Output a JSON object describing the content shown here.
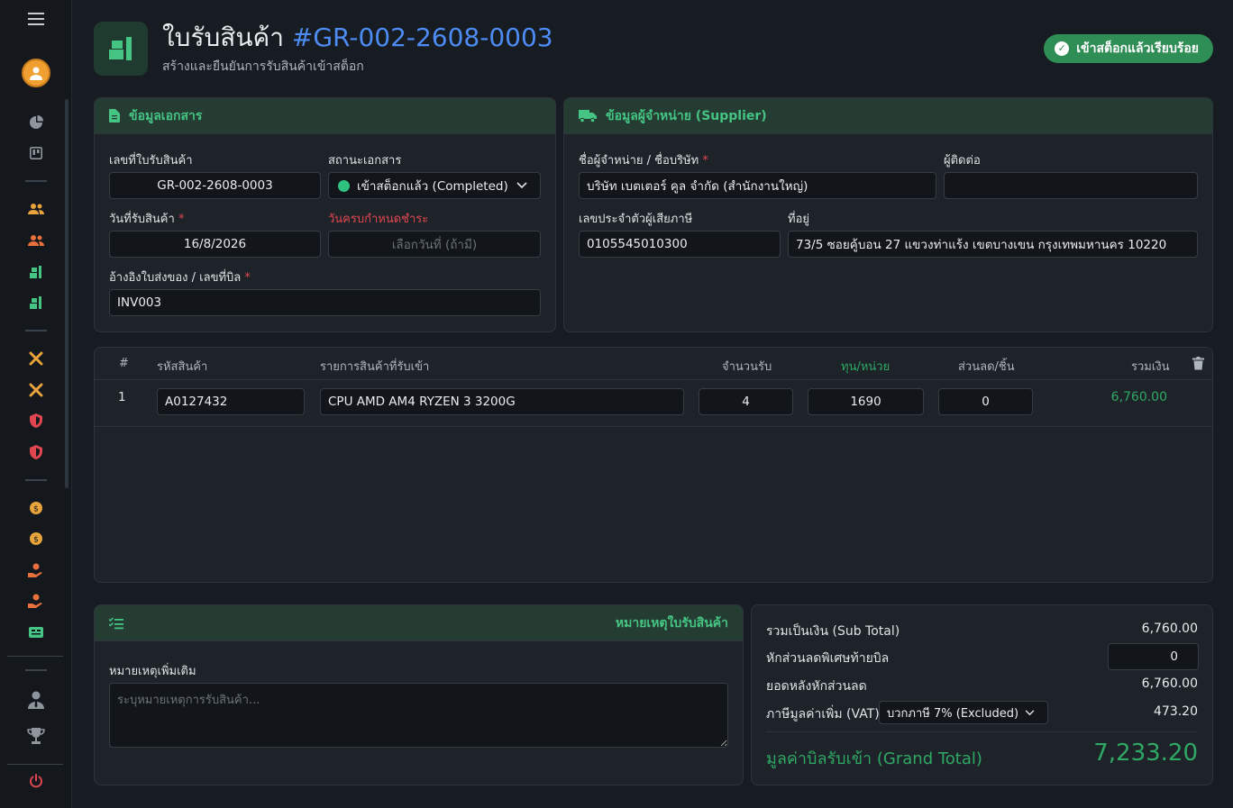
{
  "sidebar": {
    "menu_icon": "hamburger-icon",
    "avatar_icon": "user-avatar-icon",
    "items": [
      {
        "icon": "pie-chart-icon",
        "color": "#8e959c"
      },
      {
        "icon": "kanban-icon",
        "color": "#8e959c"
      },
      {
        "icon": "users-icon",
        "color": "#e8a33c"
      },
      {
        "icon": "users-icon",
        "color": "#e8a33c"
      },
      {
        "icon": "dolly-icon",
        "color": "#45c483"
      },
      {
        "icon": "dolly-icon",
        "color": "#45c483"
      },
      {
        "icon": "tools-icon",
        "color": "#e8a33c"
      },
      {
        "icon": "tools-icon",
        "color": "#e8a33c"
      },
      {
        "icon": "shield-icon",
        "color": "#e0464f"
      },
      {
        "icon": "shield-icon",
        "color": "#e0464f"
      },
      {
        "icon": "coin-icon",
        "color": "#e8a33c"
      },
      {
        "icon": "coin-icon",
        "color": "#e8a33c"
      },
      {
        "icon": "hand-money-icon",
        "color": "#e8703c"
      },
      {
        "icon": "hand-money-icon",
        "color": "#e8703c"
      },
      {
        "icon": "id-card-icon",
        "color": "#45c483"
      },
      {
        "icon": "user-tie-icon",
        "color": "#8e959c"
      },
      {
        "icon": "trophy-icon",
        "color": "#8e959c"
      },
      {
        "icon": "power-icon",
        "color": "#e0464f"
      }
    ]
  },
  "header": {
    "title": "ใบรับสินค้า",
    "doc_no": "#GR-002-2608-0003",
    "subtitle": "สร้างและยืนยันการรับสินค้าเข้าสต็อก",
    "status_badge": "เข้าสต็อกแล้วเรียบร้อย"
  },
  "doc_info": {
    "heading": "ข้อมูลเอกสาร",
    "receipt_no_label": "เลขที่ใบรับสินค้า",
    "receipt_no": "GR-002-2608-0003",
    "status_label": "สถานะเอกสาร",
    "status_value": "เข้าสต็อกแล้ว (Completed)",
    "receive_date_label": "วันที่รับสินค้า",
    "receive_date": "16/8/2026",
    "due_date_label": "วันครบกำหนดชำระ",
    "due_date_placeholder": "เลือกวันที่ (ถ้ามี)",
    "ref_label": "อ้างอิงใบส่งของ / เลขที่บิล",
    "ref_value": "INV003",
    "required_mark": "*"
  },
  "supplier": {
    "heading": "ข้อมูลผู้จำหน่าย (Supplier)",
    "name_label": "ชื่อผู้จำหน่าย / ชื่อบริษัท",
    "name": "บริษัท เบตเตอร์ คูล จำกัด (สำนักงานใหญ่)",
    "contact_label": "ผู้ติดต่อ",
    "contact": "",
    "tax_id_label": "เลขประจำตัวผู้เสียภาษี",
    "tax_id": "0105545010300",
    "address_label": "ที่อยู่",
    "address": "73/5 ซอยคู้บอน 27 แขวงท่าแร้ง เขตบางเขน กรุงเทพมหานคร 10220"
  },
  "items_table": {
    "headers": {
      "index": "#",
      "code": "รหัสสินค้า",
      "name": "รายการสินค้าที่รับเข้า",
      "qty": "จำนวนรับ",
      "cost": "ทุน/หน่วย",
      "discount": "ส่วนลด/ชิ้น",
      "total": "รวมเงิน"
    },
    "rows": [
      {
        "index": "1",
        "code": "A0127432",
        "name": "CPU AMD AM4 RYZEN 3 3200G",
        "qty": "4",
        "cost": "1690",
        "discount": "0",
        "total": "6,760.00"
      }
    ]
  },
  "notes": {
    "heading": "หมายเหตุใบรับสินค้า",
    "label": "หมายเหตุเพิ่มเติม",
    "placeholder": "ระบุหมายเหตุการรับสินค้า...",
    "value": ""
  },
  "summary": {
    "subtotal_label": "รวมเป็นเงิน (Sub Total)",
    "subtotal": "6,760.00",
    "bill_discount_label": "หักส่วนลดพิเศษท้ายบิล",
    "bill_discount": "0",
    "after_discount_label": "ยอดหลังหักส่วนลด",
    "after_discount": "6,760.00",
    "vat_label": "ภาษีมูลค่าเพิ่ม (VAT)",
    "vat_option": "บวกภาษี 7% (Excluded)",
    "vat": "473.20",
    "grand_label": "มูลค่าบิลรับเข้า (Grand Total)",
    "grand_total": "7,233.20"
  },
  "colors": {
    "accent_green": "#2fa865",
    "link_blue": "#4d8bf5",
    "required_red": "#e0464f",
    "badge_green": "#2f8d56"
  }
}
